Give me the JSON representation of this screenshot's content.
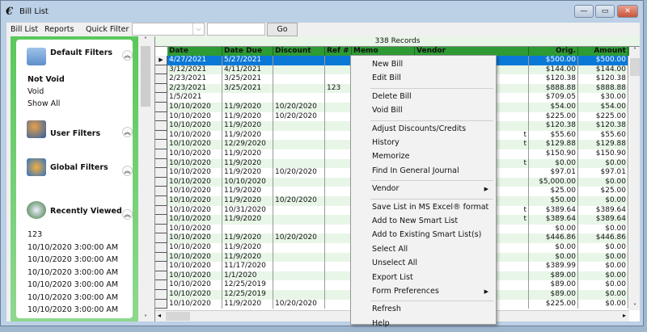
{
  "window": {
    "title": "Bill List",
    "minimize": "—",
    "maximize": "▭",
    "close": "✕"
  },
  "menubar": {
    "bill_list": "Bill List",
    "reports": "Reports",
    "quick_filter": "Quick Filter",
    "quick_filter_value": "",
    "search_value": "",
    "go": "Go"
  },
  "left_panel": {
    "default_filters": {
      "title": "Default Filters",
      "items": [
        "Not Void",
        "Void",
        "Show All"
      ],
      "active": "Not Void"
    },
    "user_filters": {
      "title": "User Filters"
    },
    "global_filters": {
      "title": "Global Filters"
    },
    "recently_viewed": {
      "title": "Recently Viewed",
      "items": [
        "123",
        "10/10/2020 3:00:00 AM",
        "10/10/2020 3:00:00 AM",
        "10/10/2020 3:00:00 AM",
        "10/10/2020 3:00:00 AM",
        "10/10/2020 3:00:00 AM",
        "10/10/2020 3:00:00 AM"
      ]
    }
  },
  "grid": {
    "records_label": "338 Records",
    "columns": [
      "Date",
      "Date Due",
      "Discount",
      "Ref #",
      "Memo",
      "Vendor",
      "Orig.",
      "Amount"
    ],
    "rows": [
      [
        "4/27/2021",
        "5/27/2021",
        "",
        "",
        "",
        "",
        "$500.00",
        "$500.00"
      ],
      [
        "3/12/2021",
        "4/11/2021",
        "",
        "",
        "",
        "",
        "$144.00",
        "$144.00"
      ],
      [
        "2/23/2021",
        "3/25/2021",
        "",
        "",
        "",
        "",
        "$120.38",
        "$120.38"
      ],
      [
        "2/23/2021",
        "3/25/2021",
        "",
        "123",
        "",
        "",
        "$888.88",
        "$888.88"
      ],
      [
        "1/5/2021",
        "",
        "",
        "",
        "",
        "",
        "$709.05",
        "$30.00"
      ],
      [
        "10/10/2020",
        "11/9/2020",
        "10/20/2020",
        "",
        "",
        "",
        "$54.00",
        "$54.00"
      ],
      [
        "10/10/2020",
        "11/9/2020",
        "10/20/2020",
        "",
        "",
        "",
        "$225.00",
        "$225.00"
      ],
      [
        "10/10/2020",
        "11/9/2020",
        "",
        "",
        "",
        "",
        "$120.38",
        "$120.38"
      ],
      [
        "10/10/2020",
        "11/9/2020",
        "",
        "",
        "",
        "t",
        "$55.60",
        "$55.60"
      ],
      [
        "10/10/2020",
        "12/29/2020",
        "",
        "",
        "",
        "t",
        "$129.88",
        "$129.88"
      ],
      [
        "10/10/2020",
        "11/9/2020",
        "",
        "",
        "",
        "",
        "$150.90",
        "$150.90"
      ],
      [
        "10/10/2020",
        "11/9/2020",
        "",
        "",
        "",
        "t",
        "$0.00",
        "$0.00"
      ],
      [
        "10/10/2020",
        "11/9/2020",
        "10/20/2020",
        "",
        "",
        "",
        "$97.01",
        "$97.01"
      ],
      [
        "10/10/2020",
        "10/10/2020",
        "",
        "",
        "",
        "",
        "$5,000.00",
        "$0.00"
      ],
      [
        "10/10/2020",
        "11/9/2020",
        "",
        "",
        "",
        "",
        "$25.00",
        "$25.00"
      ],
      [
        "10/10/2020",
        "11/9/2020",
        "10/20/2020",
        "",
        "",
        "",
        "$50.00",
        "$0.00"
      ],
      [
        "10/10/2020",
        "10/31/2020",
        "",
        "",
        "",
        "t",
        "$389.64",
        "$389.64"
      ],
      [
        "10/10/2020",
        "11/9/2020",
        "",
        "",
        "",
        "t",
        "$389.64",
        "$389.64"
      ],
      [
        "10/10/2020",
        "",
        "",
        "",
        "",
        "",
        "$0.00",
        "$0.00"
      ],
      [
        "10/10/2020",
        "11/9/2020",
        "10/20/2020",
        "",
        "",
        "",
        "$446.86",
        "$446.86"
      ],
      [
        "10/10/2020",
        "11/9/2020",
        "",
        "",
        "",
        "",
        "$0.00",
        "$0.00"
      ],
      [
        "10/10/2020",
        "11/9/2020",
        "",
        "",
        "",
        "",
        "$0.00",
        "$0.00"
      ],
      [
        "10/10/2020",
        "11/17/2020",
        "",
        "",
        "",
        "",
        "$389.99",
        "$0.00"
      ],
      [
        "10/10/2020",
        "1/1/2020",
        "",
        "",
        "",
        "",
        "$89.00",
        "$0.00"
      ],
      [
        "10/10/2020",
        "12/25/2019",
        "",
        "",
        "",
        "",
        "$89.00",
        "$0.00"
      ],
      [
        "10/10/2020",
        "12/25/2019",
        "",
        "",
        "",
        "",
        "$89.00",
        "$0.00"
      ],
      [
        "10/10/2020",
        "11/9/2020",
        "10/20/2020",
        "",
        "",
        "",
        "$225.00",
        "$0.00"
      ]
    ]
  },
  "context_menu": {
    "items": [
      {
        "label": "New Bill"
      },
      {
        "label": "Edit Bill"
      },
      {
        "sep": true
      },
      {
        "label": "Delete Bill"
      },
      {
        "label": "Void Bill"
      },
      {
        "sep": true
      },
      {
        "label": "Adjust Discounts/Credits"
      },
      {
        "label": "History"
      },
      {
        "label": "Memorize"
      },
      {
        "label": "Find In General Journal"
      },
      {
        "sep": true
      },
      {
        "label": "Vendor",
        "submenu": true
      },
      {
        "sep": true
      },
      {
        "label": "Save List in MS Excel® format"
      },
      {
        "label": "Add to New Smart List"
      },
      {
        "label": "Add to Existing Smart List(s)"
      },
      {
        "label": "Select All"
      },
      {
        "label": "Unselect All"
      },
      {
        "label": "Export List"
      },
      {
        "label": "Form Preferences",
        "submenu": true
      },
      {
        "sep": true
      },
      {
        "label": "Refresh"
      },
      {
        "label": "Help"
      }
    ]
  },
  "colors": {
    "header_green": "#2e9a34",
    "panel_green": "#5ac85a",
    "selected_row": "#0a78d7",
    "alt_row": "#e8f6e8"
  }
}
